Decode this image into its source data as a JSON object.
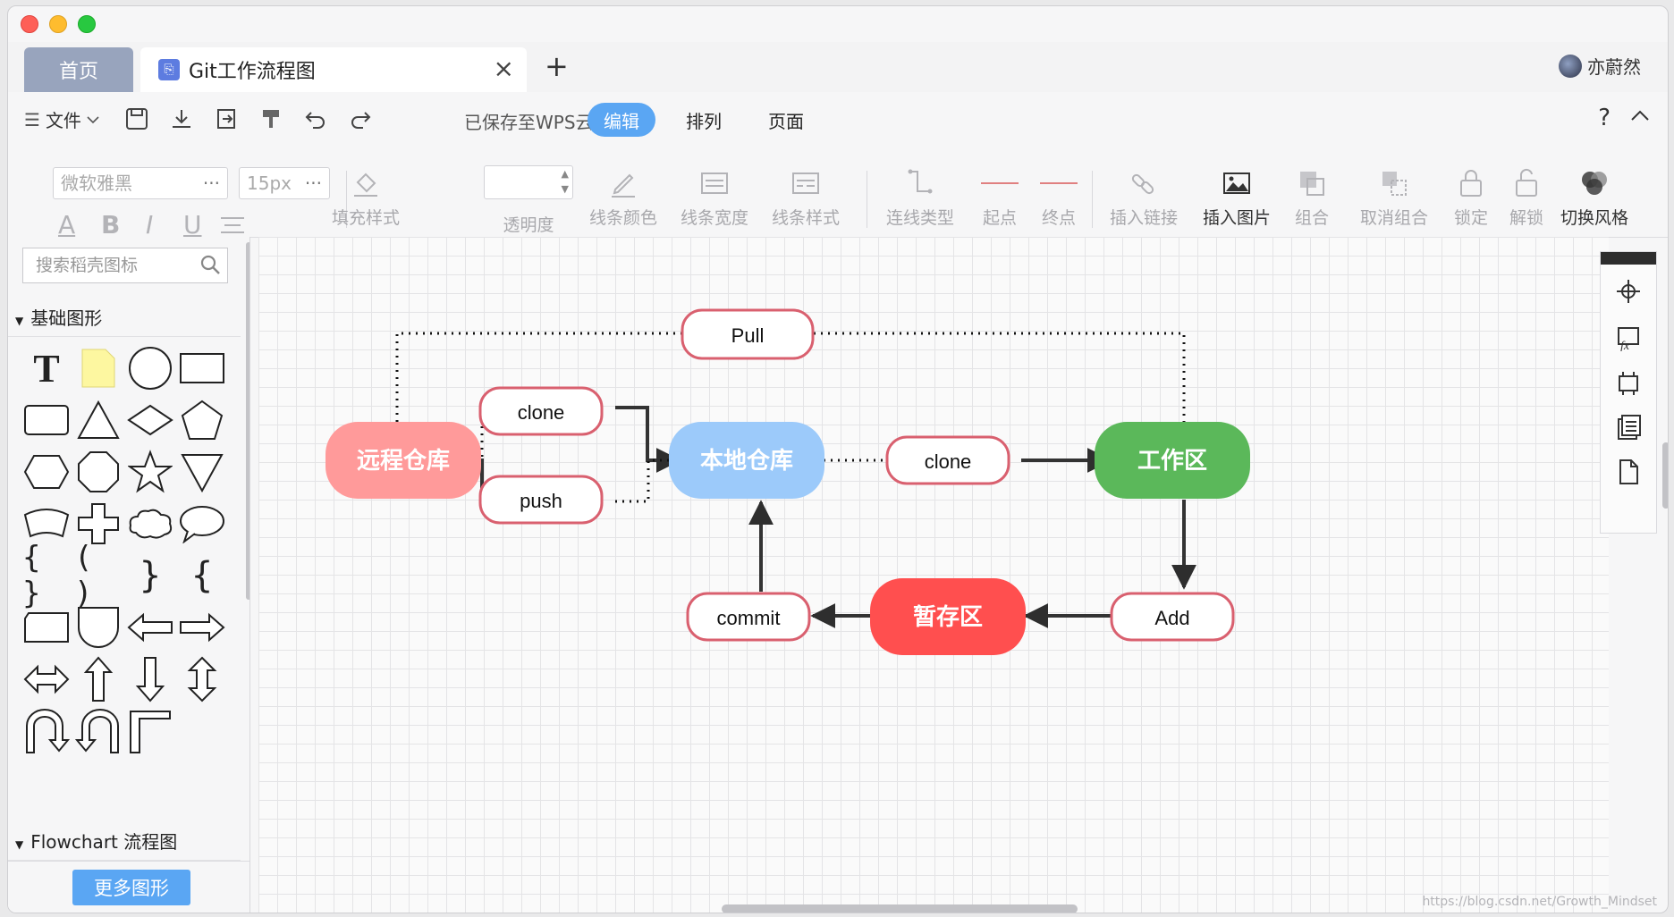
{
  "tabs": {
    "home": "首页",
    "doc": "Git工作流程图",
    "add": "+",
    "user": "亦蔚然"
  },
  "menubar": {
    "file": "文件",
    "saved_status": "已保存至WPS云文档",
    "segments": [
      "编辑",
      "排列",
      "页面"
    ],
    "active_segment": "编辑",
    "help": "?"
  },
  "toolbar": {
    "font": "微软雅黑",
    "size": "15px",
    "format": [
      "A",
      "B",
      "I",
      "U"
    ],
    "tools": [
      "填充样式",
      "透明度",
      "线条颜色",
      "线条宽度",
      "线条样式",
      "连线类型",
      "起点",
      "终点",
      "插入链接",
      "插入图片",
      "组合",
      "取消组合",
      "锁定",
      "解锁",
      "切换风格"
    ]
  },
  "sidebar": {
    "search_placeholder": "搜索稻壳图标",
    "group_basic": "基础图形",
    "group_flow": "Flowchart 流程图",
    "more_button": "更多图形"
  },
  "diagram": {
    "nodes": {
      "remote": "远程仓库",
      "local": "本地仓库",
      "workspace": "工作区",
      "staging": "暂存区",
      "pull": "Pull",
      "clone_top": "clone",
      "push": "push",
      "clone_right": "clone",
      "commit": "commit",
      "add": "Add"
    },
    "colors": {
      "remote": "#ff9a9a",
      "local": "#9ccafa",
      "workspace": "#5bb85a",
      "staging": "#ff4f4f",
      "pill_border": "#d9606f"
    }
  },
  "watermark": "https://blog.csdn.net/Growth_Mindset"
}
